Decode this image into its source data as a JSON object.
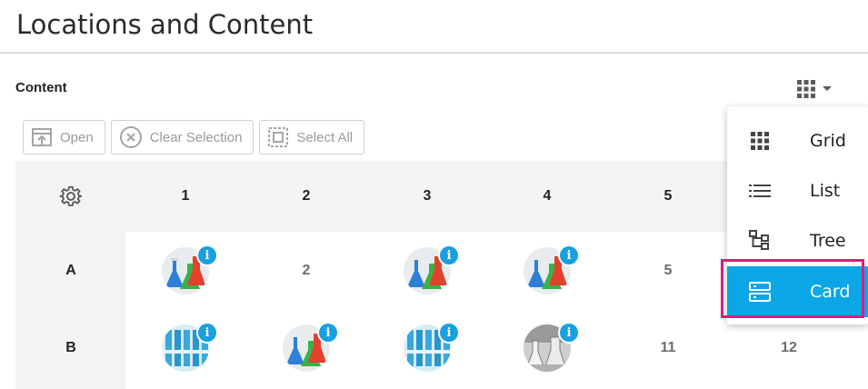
{
  "page": {
    "title": "Locations and Content"
  },
  "section": {
    "label": "Content"
  },
  "view_toggle": {
    "icon": "grid-icon",
    "caret": "caret-down-icon"
  },
  "toolbar": {
    "open_label": "Open",
    "clear_selection_label": "Clear Selection",
    "select_all_label": "Select All"
  },
  "grid": {
    "settings_icon": "gear-icon",
    "columns": [
      "1",
      "2",
      "3",
      "4",
      "5"
    ],
    "rows": [
      {
        "label": "A",
        "cells": [
          {
            "type": "image",
            "image": "flasks"
          },
          {
            "type": "number",
            "text": "2"
          },
          {
            "type": "image",
            "image": "flasks"
          },
          {
            "type": "image",
            "image": "flasks"
          },
          {
            "type": "number",
            "text": "5"
          }
        ]
      },
      {
        "label": "B",
        "cells": [
          {
            "type": "image",
            "image": "test-tubes"
          },
          {
            "type": "image",
            "image": "flasks"
          },
          {
            "type": "image",
            "image": "test-tubes"
          },
          {
            "type": "image",
            "image": "lab-glass-gray"
          },
          {
            "type": "number",
            "text": "11"
          },
          {
            "type": "number",
            "text": "12"
          }
        ]
      }
    ]
  },
  "view_menu": {
    "items": [
      {
        "label": "Grid",
        "icon": "grid-icon",
        "selected": false
      },
      {
        "label": "List",
        "icon": "list-icon",
        "selected": false
      },
      {
        "label": "Tree",
        "icon": "tree-icon",
        "selected": false
      },
      {
        "label": "Card",
        "icon": "card-icon",
        "selected": true
      }
    ]
  },
  "colors": {
    "accent": "#0aa6e6",
    "info_badge": "#1a9fe0",
    "highlight": "#e6187c",
    "grid_background": "#f4f4f4"
  }
}
